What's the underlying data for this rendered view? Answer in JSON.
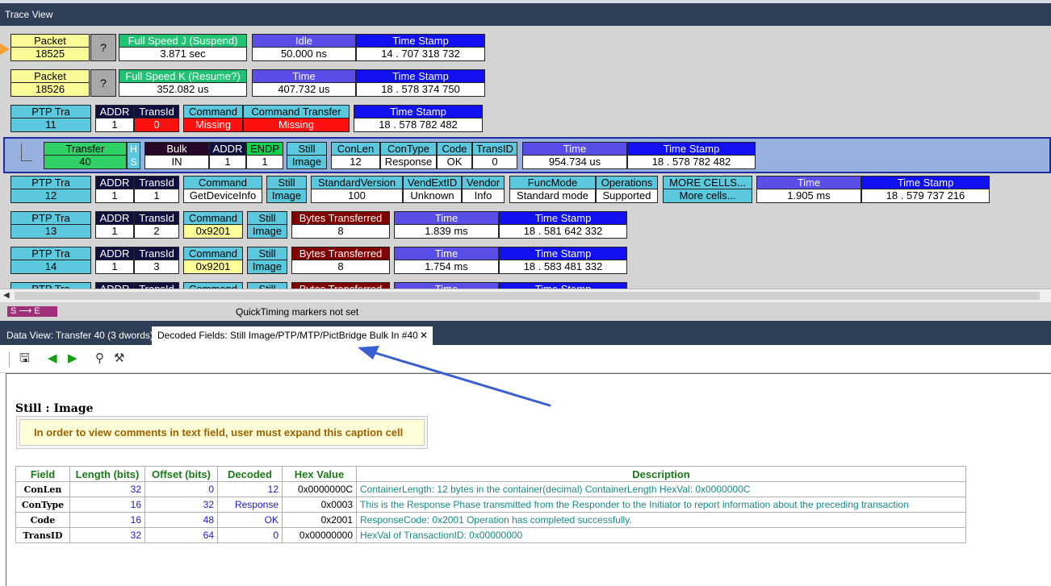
{
  "window": {
    "title": "Trace View"
  },
  "trace": {
    "row1": {
      "packet_h": "Packet",
      "packet_v": "18525",
      "q": "?",
      "fsj_h": "Full Speed J (Suspend)",
      "fsj_v": "3.871 sec",
      "idle_h": "Idle",
      "idle_v": "50.000 ns",
      "ts_h": "Time Stamp",
      "ts_v": "14 . 707 318 732"
    },
    "row2": {
      "packet_h": "Packet",
      "packet_v": "18526",
      "q": "?",
      "fsk_h": "Full Speed K (Resume?)",
      "fsk_v": "352.082 us",
      "time_h": "Time",
      "time_v": "407.732 us",
      "ts_h": "Time Stamp",
      "ts_v": "18 . 578 374 750"
    },
    "row3": {
      "ptp_h": "PTP Tra",
      "ptp_v": "11",
      "addr_h": "ADDR",
      "addr_v": "1",
      "tid_h": "TransId",
      "tid_v": "0",
      "cmd_h": "Command",
      "cmd_v": "Missing",
      "ct_h": "Command Transfer",
      "ct_v": "Missing",
      "ts_h": "Time Stamp",
      "ts_v": "18 . 578 782 482"
    },
    "row4": {
      "xfer_h": "Transfer",
      "xfer_v": "40",
      "hs_h": "H",
      "hs_v": "S",
      "bulk_h": "Bulk",
      "bulk_v": "IN",
      "addr_h": "ADDR",
      "addr_v": "1",
      "endp_h": "ENDP",
      "endp_v": "1",
      "still_h": "Still",
      "still_v": "Image",
      "conlen_h": "ConLen",
      "conlen_v": "12",
      "contype_h": "ConType",
      "contype_v": "Response",
      "code_h": "Code",
      "code_v": "OK",
      "transid_h": "TransID",
      "transid_v": "0",
      "time_h": "Time",
      "time_v": "954.734 us",
      "ts_h": "Time Stamp",
      "ts_v": "18 . 578 782 482"
    },
    "row5": {
      "ptp_h": "PTP Tra",
      "ptp_v": "12",
      "addr_h": "ADDR",
      "addr_v": "1",
      "tid_h": "TransId",
      "tid_v": "1",
      "cmd_h": "Command",
      "cmd_v": "GetDeviceInfo",
      "still_h": "Still",
      "still_v": "Image",
      "sv_h": "StandardVersion",
      "sv_v": "100",
      "vext_h": "VendExtID",
      "vext_v": "Unknown",
      "vendor_h": "Vendor",
      "vendor_v": "Info",
      "func_h": "FuncMode",
      "func_v": "Standard mode",
      "ops_h": "Operations",
      "ops_v": "Supported",
      "more_h": "MORE CELLS...",
      "more_v": "More cells...",
      "time_h": "Time",
      "time_v": "1.905 ms",
      "ts_h": "Time Stamp",
      "ts_v": "18 . 579 737 216"
    },
    "row6": {
      "ptp_h": "PTP Tra",
      "ptp_v": "13",
      "addr_h": "ADDR",
      "addr_v": "1",
      "tid_h": "TransId",
      "tid_v": "2",
      "cmd_h": "Command",
      "cmd_v": "0x9201",
      "still_h": "Still",
      "still_v": "Image",
      "bt_h": "Bytes Transferred",
      "bt_v": "8",
      "time_h": "Time",
      "time_v": "1.839 ms",
      "ts_h": "Time Stamp",
      "ts_v": "18 . 581 642 332"
    },
    "row7": {
      "ptp_h": "PTP Tra",
      "ptp_v": "14",
      "addr_h": "ADDR",
      "addr_v": "1",
      "tid_h": "TransId",
      "tid_v": "3",
      "cmd_h": "Command",
      "cmd_v": "0x9201",
      "still_h": "Still",
      "still_v": "Image",
      "bt_h": "Bytes Transferred",
      "bt_v": "8",
      "time_h": "Time",
      "time_v": "1.754 ms",
      "ts_h": "Time Stamp",
      "ts_v": "18 . 583 481 332"
    },
    "row8": {
      "ptp_h": "PTP Tra",
      "addr_h": "ADDR",
      "tid_h": "TransId",
      "cmd_h": "Command",
      "still_h": "Still",
      "bt_h": "Bytes Transferred",
      "time_h": "Time",
      "ts_h": "Time Stamp"
    }
  },
  "markers": {
    "se_label": "S ⟶ E",
    "quicktiming": "QuickTiming markers not set"
  },
  "tabs": {
    "data_view": "Data View: Transfer 40 (3 dwords)",
    "decoded": "Decoded Fields: Still Image/PTP/MTP/PictBridge Bulk In #40",
    "close": "✕"
  },
  "toolbar": {
    "save": "🖫",
    "prev": "◀",
    "next": "▶",
    "find": "⚲",
    "tool": "⚒"
  },
  "decoded": {
    "title": "Still : Image",
    "note": "In order to view comments in text field, user must expand this caption cell",
    "headers": [
      "Field",
      "Length (bits)",
      "Offset (bits)",
      "Decoded",
      "Hex Value",
      "Description"
    ],
    "rows": [
      [
        "ConLen",
        "32",
        "0",
        "12",
        "0x0000000C",
        "ContainerLength: 12 bytes in the container(decimal) ContainerLength HexVal: 0x0000000C"
      ],
      [
        "ConType",
        "16",
        "32",
        "Response",
        "0x0003",
        "This is the Response Phase transmitted from the Responder to the Initiator to report information about the preceding transaction"
      ],
      [
        "Code",
        "16",
        "48",
        "OK",
        "0x2001",
        "ResponseCode: 0x2001 Operation has completed successfully."
      ],
      [
        "TransID",
        "32",
        "64",
        "0",
        "0x00000000",
        "HexVal of TransactionID: 0x00000000"
      ]
    ]
  },
  "colors": {
    "accent": "#2d3e56",
    "selection": "#98b0e0",
    "annotation_arrow": "#3a5fd0"
  }
}
